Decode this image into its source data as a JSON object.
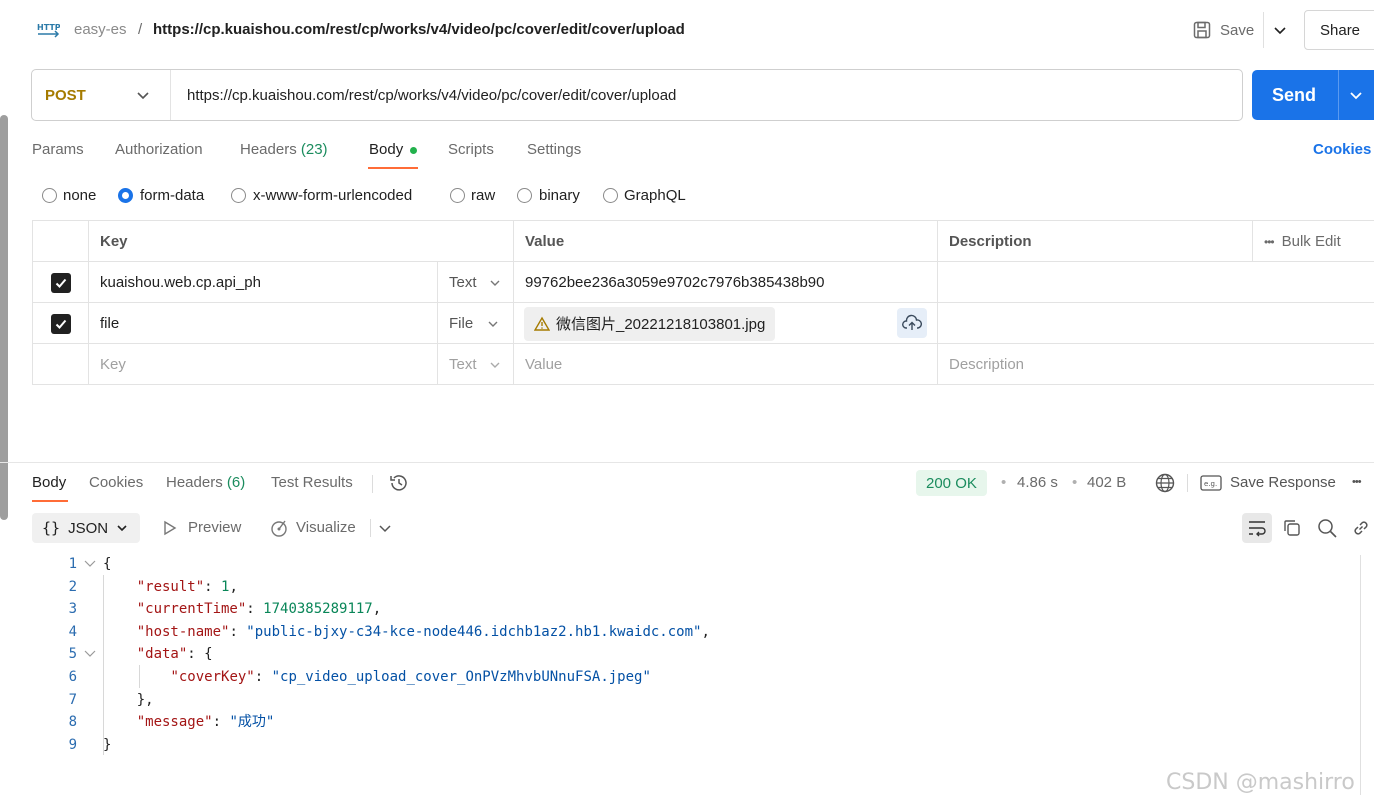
{
  "header": {
    "icon_text": "HTTP",
    "collection": "easy-es",
    "separator": "/",
    "title": "https://cp.kuaishou.com/rest/cp/works/v4/video/pc/cover/edit/cover/upload",
    "save_label": "Save",
    "share_label": "Share"
  },
  "request": {
    "method": "POST",
    "url": "https://cp.kuaishou.com/rest/cp/works/v4/video/pc/cover/edit/cover/upload",
    "send_label": "Send"
  },
  "tabs": {
    "params": "Params",
    "authorization": "Authorization",
    "headers": "Headers",
    "headers_count": "(23)",
    "body": "Body",
    "scripts": "Scripts",
    "settings": "Settings",
    "cookies": "Cookies"
  },
  "body_types": {
    "none": "none",
    "form_data": "form-data",
    "urlencoded": "x-www-form-urlencoded",
    "raw": "raw",
    "binary": "binary",
    "graphql": "GraphQL",
    "selected": "form-data"
  },
  "table": {
    "col_key": "Key",
    "col_value": "Value",
    "col_description": "Description",
    "bulk_edit": "Bulk Edit",
    "rows": [
      {
        "key": "kuaishou.web.cp.api_ph",
        "type": "Text",
        "value": "99762bee236a3059e9702c7976b385438b90",
        "checked": true
      },
      {
        "key": "file",
        "type": "File",
        "value": "微信图片_20221218103801.jpg",
        "checked": true
      }
    ],
    "placeholder_key": "Key",
    "placeholder_type": "Text",
    "placeholder_value": "Value",
    "placeholder_description": "Description"
  },
  "response": {
    "tabs": {
      "body": "Body",
      "cookies": "Cookies",
      "headers": "Headers",
      "headers_count": "(6)",
      "test_results": "Test Results"
    },
    "status": "200 OK",
    "time": "4.86 s",
    "size": "402 B",
    "save_response": "Save Response",
    "format": "JSON",
    "preview": "Preview",
    "visualize": "Visualize"
  },
  "code_lines": [
    {
      "num": "1"
    },
    {
      "num": "2"
    },
    {
      "num": "3"
    },
    {
      "num": "4"
    },
    {
      "num": "5"
    },
    {
      "num": "6"
    },
    {
      "num": "7"
    },
    {
      "num": "8"
    },
    {
      "num": "9"
    }
  ],
  "json": {
    "open_brace": "{",
    "result_key": "\"result\"",
    "result_val": "1",
    "currentTime_key": "\"currentTime\"",
    "currentTime_val": "1740385289117",
    "hostname_key": "\"host-name\"",
    "hostname_val": "\"public-bjxy-c34-kce-node446.idchb1az2.hb1.kwaidc.com\"",
    "data_key": "\"data\"",
    "coverKey_key": "\"coverKey\"",
    "coverKey_val": "\"cp_video_upload_cover_OnPVzMhvbUNnuFSA.jpeg\"",
    "data_close": "},",
    "message_key": "\"message\"",
    "message_val": "\"成功\"",
    "close_brace": "}"
  },
  "watermark": "CSDN @mashirro",
  "colors": {
    "send": "#1a73e8",
    "method": "#a57b00",
    "status_ok": "#1b8c5e",
    "tab_active": "#ff6c37"
  }
}
